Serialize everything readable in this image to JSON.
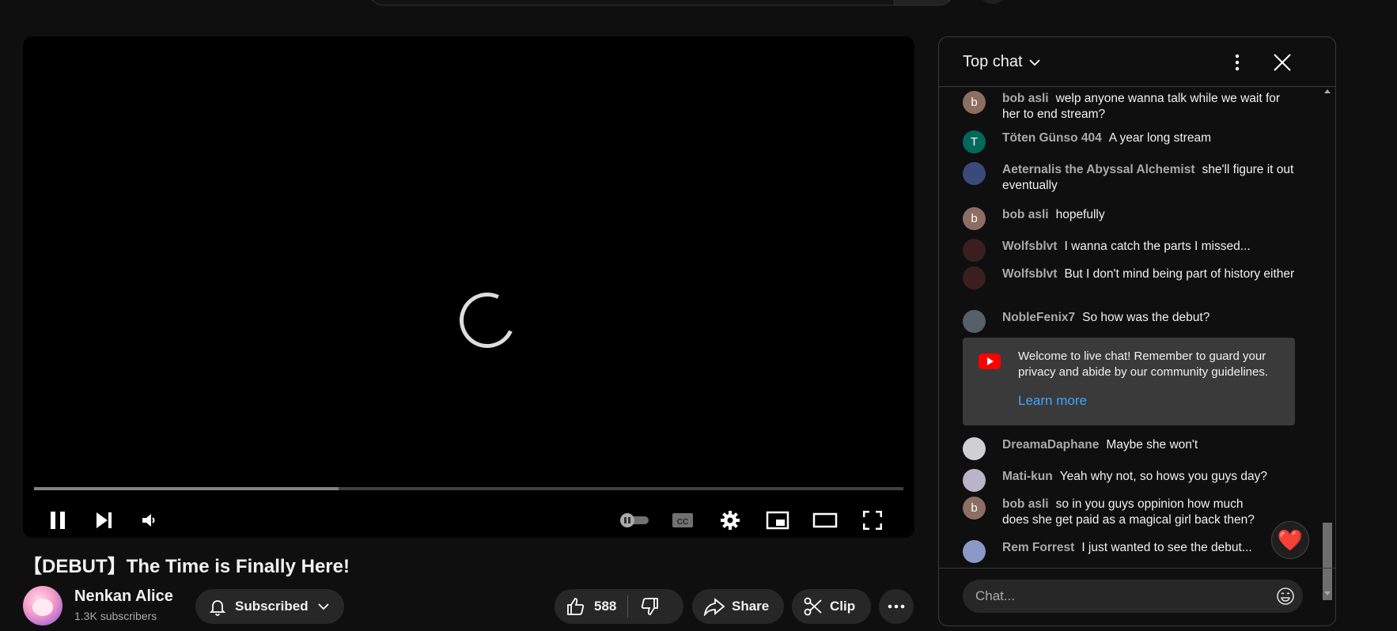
{
  "video": {
    "title": "【DEBUT】The Time is Finally Here!",
    "progress_fraction": 0.35
  },
  "channel": {
    "name": "Nenkan Alice",
    "subscribers": "1.3K subscribers",
    "subscribe_label": "Subscribed"
  },
  "actions": {
    "like_count": "588",
    "share_label": "Share",
    "clip_label": "Clip"
  },
  "chat": {
    "title": "Top chat",
    "placeholder": "Chat...",
    "messages": [
      {
        "author": "bob asli",
        "text": "welp anyone wanna talk while we wait for her to end stream?",
        "avatar_letter": "b",
        "avatar_color": "#8d6e63"
      },
      {
        "author": "Töten Günso 404",
        "text": "A year long stream",
        "avatar_letter": "T",
        "avatar_color": "#00695c"
      },
      {
        "author": "Aeternalis the Abyssal Alchemist",
        "text": "she'll figure it out eventually",
        "avatar_letter": "",
        "avatar_color": "#3a4a7a"
      },
      {
        "author": "bob asli",
        "text": "hopefully",
        "avatar_letter": "b",
        "avatar_color": "#8d6e63"
      },
      {
        "author": "Wolfsblvt",
        "text": "I wanna catch the parts I missed...",
        "avatar_letter": "",
        "avatar_color": "#3b1f1f"
      },
      {
        "author": "Wolfsblvt",
        "text": "But I don't mind being part of history either",
        "avatar_letter": "",
        "avatar_color": "#3b1f1f"
      },
      {
        "author": "NobleFenix7",
        "text": "So how was the debut?",
        "avatar_letter": "",
        "avatar_color": "#55606a"
      },
      {
        "author": "DreamaDaphane",
        "text": "Maybe she won't",
        "avatar_letter": "",
        "avatar_color": "#cfcfd4"
      },
      {
        "author": "Mati-kun",
        "text": "Yeah why not, so hows you guys day?",
        "avatar_letter": "",
        "avatar_color": "#b9b4c7"
      },
      {
        "author": "bob asli",
        "text": "so in you guys oppinion how much does she get paid as a magical girl back then?",
        "avatar_letter": "b",
        "avatar_color": "#8d6e63"
      },
      {
        "author": "Rem Forrest",
        "text": "I just wanted to see the debut...",
        "avatar_letter": "",
        "avatar_color": "#8c98c6"
      }
    ],
    "welcome": {
      "text": "Welcome to live chat! Remember to guard your privacy and abide by our community guidelines.",
      "link": "Learn more"
    },
    "reaction": "❤️"
  }
}
